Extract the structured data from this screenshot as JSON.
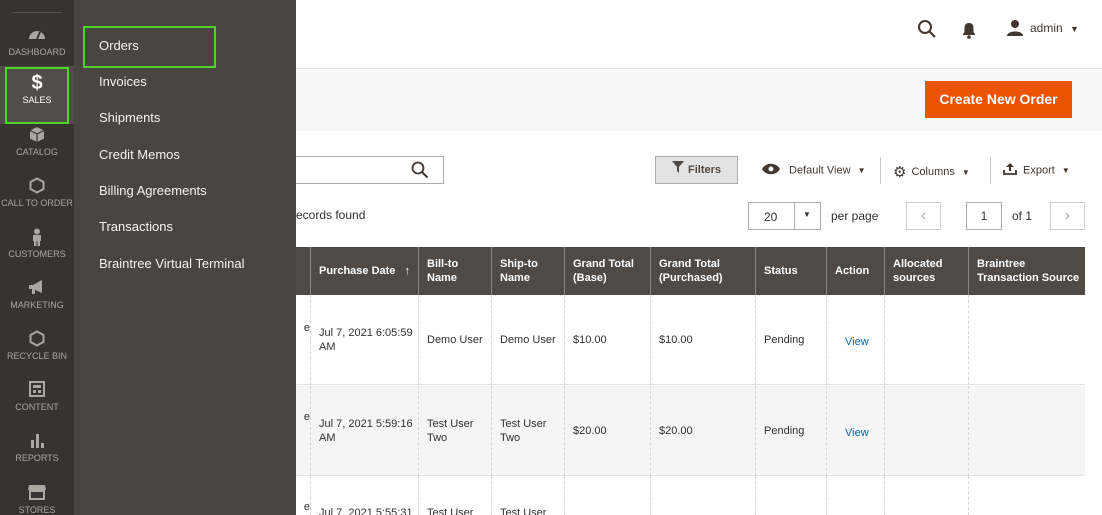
{
  "nav": {
    "items": [
      {
        "label": "DASHBOARD",
        "icon": "dashboard-icon"
      },
      {
        "label": "SALES",
        "icon": "dollar-icon"
      },
      {
        "label": "CATALOG",
        "icon": "box-icon"
      },
      {
        "label": "CALL TO ORDER",
        "icon": "hexagon-icon"
      },
      {
        "label": "CUSTOMERS",
        "icon": "person-icon"
      },
      {
        "label": "MARKETING",
        "icon": "megaphone-icon"
      },
      {
        "label": "RECYCLE BIN",
        "icon": "hexagon-icon"
      },
      {
        "label": "CONTENT",
        "icon": "layout-icon"
      },
      {
        "label": "REPORTS",
        "icon": "bar-chart-icon"
      },
      {
        "label": "STORES",
        "icon": "store-icon"
      }
    ],
    "sales_symbol": "$"
  },
  "submenu": {
    "items": [
      "Orders",
      "Invoices",
      "Shipments",
      "Credit Memos",
      "Billing Agreements",
      "Transactions",
      "Braintree Virtual Terminal"
    ]
  },
  "header": {
    "admin_label": "admin"
  },
  "actions": {
    "create_new_order": "Create New Order"
  },
  "toolbar": {
    "filters": "Filters",
    "default_view": "Default View",
    "columns": "Columns",
    "export": "Export",
    "records_found": "ecords found",
    "per_page_value": "20",
    "per_page_label": "per page",
    "page_current": "1",
    "page_of": "of 1"
  },
  "grid": {
    "columns": [
      "Purchase Date",
      "Bill-to Name",
      "Ship-to Name",
      "Grand Total (Base)",
      "Grand Total (Purchased)",
      "Status",
      "Action",
      "Allocated sources",
      "Braintree Transaction Source"
    ],
    "sort_indicator": "↑",
    "rows": [
      {
        "stub": "e",
        "purchase_date": "Jul 7, 2021 6:05:59 AM",
        "bill_to": "Demo User",
        "ship_to": "Demo User",
        "total_base": "$10.00",
        "total_purchased": "$10.00",
        "status": "Pending",
        "action": "View"
      },
      {
        "stub": "e",
        "purchase_date": "Jul 7, 2021 5:59:16 AM",
        "bill_to": "Test User Two",
        "ship_to": "Test User Two",
        "total_base": "$20.00",
        "total_purchased": "$20.00",
        "status": "Pending",
        "action": "View"
      },
      {
        "stub": "e",
        "purchase_date": "Jul 7, 2021 5:55:31",
        "bill_to": "Test User",
        "ship_to": "Test User",
        "total_base": "",
        "total_purchased": "",
        "status": "",
        "action": ""
      }
    ]
  },
  "colors": {
    "nav_bg": "#373330",
    "flyout_bg": "#4a4542",
    "accent": "#eb5202",
    "highlight": "#4fd42a",
    "grid_header": "#514943",
    "link": "#006bb4"
  }
}
